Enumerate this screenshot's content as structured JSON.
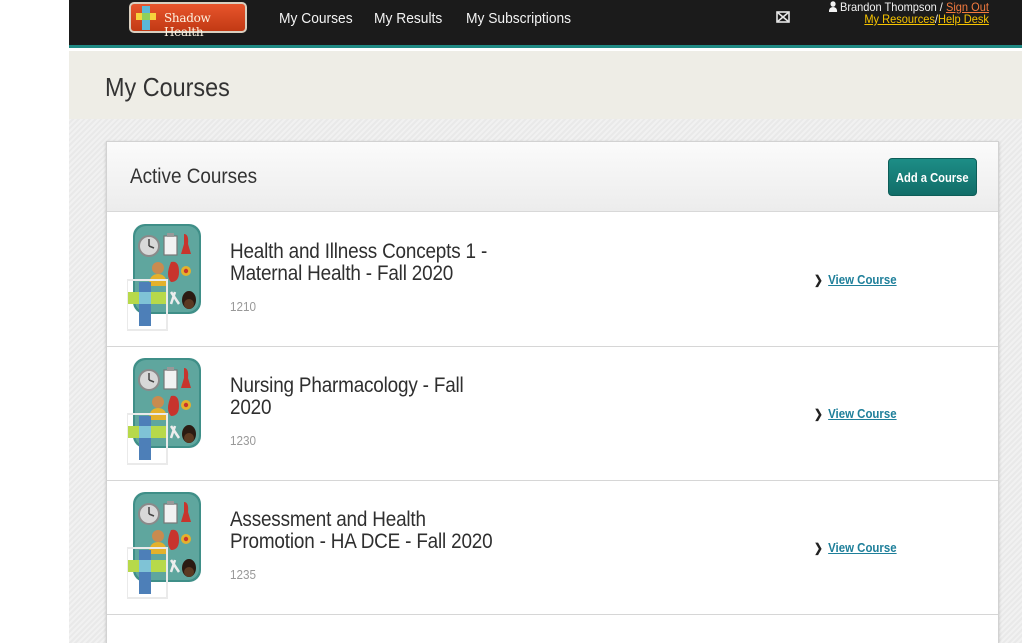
{
  "brand": {
    "logo_text": "Shadow Health"
  },
  "nav": {
    "my_courses": "My Courses",
    "my_results": "My Results",
    "my_subscriptions": "My Subscriptions"
  },
  "icons": {
    "mail": "mail-icon",
    "user": "user-icon"
  },
  "user": {
    "name": "Brandon Thompson",
    "separator": "/",
    "sign_out": "Sign Out",
    "my_resources": "My Resources",
    "help_desk": "Help Desk"
  },
  "page": {
    "title": "My Courses"
  },
  "panel": {
    "title": "Active Courses",
    "add_button": "Add a Course"
  },
  "courses": [
    {
      "title": "Health and Illness Concepts 1 - Maternal Health - Fall 2020",
      "code": "1210",
      "link": "View Course"
    },
    {
      "title": "Nursing Pharmacology - Fall 2020",
      "code": "1230",
      "link": "View Course"
    },
    {
      "title": "Assessment and Health Promotion - HA DCE - Fall 2020",
      "code": "1235",
      "link": "View Course"
    }
  ],
  "colors": {
    "topbar": "#1b1b1b",
    "accent_teal": "#1d8d86",
    "link_orange": "#f37a3f",
    "link_yellow": "#f7c400",
    "link_blue": "#1e7f9a"
  }
}
